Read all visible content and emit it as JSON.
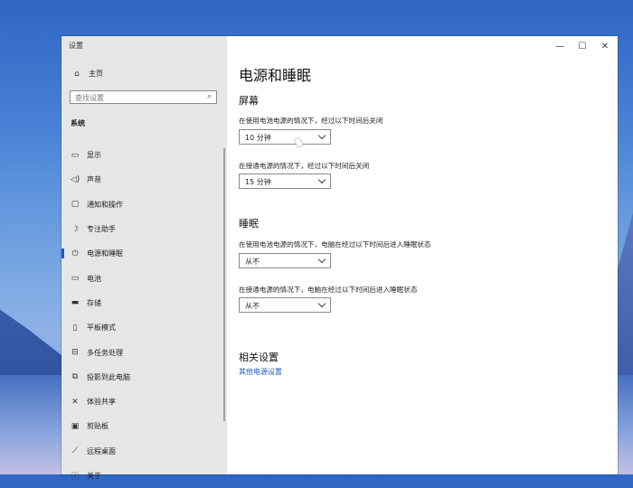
{
  "window": {
    "title": "设置",
    "controls": [
      "—",
      "☐",
      "✕"
    ]
  },
  "sidebar": {
    "home_label": "主页",
    "search_placeholder": "查找设置",
    "section": "系统",
    "items": [
      {
        "label": "显示",
        "icon": "display-icon"
      },
      {
        "label": "声音",
        "icon": "speaker-icon"
      },
      {
        "label": "通知和操作",
        "icon": "notification-icon"
      },
      {
        "label": "专注助手",
        "icon": "moon-icon"
      },
      {
        "label": "电源和睡眠",
        "icon": "power-icon",
        "active": true
      },
      {
        "label": "电池",
        "icon": "battery-icon"
      },
      {
        "label": "存储",
        "icon": "storage-icon"
      },
      {
        "label": "平板模式",
        "icon": "tablet-icon"
      },
      {
        "label": "多任务处理",
        "icon": "multitask-icon"
      },
      {
        "label": "投影到此电脑",
        "icon": "project-icon"
      },
      {
        "label": "体验共享",
        "icon": "share-icon"
      },
      {
        "label": "剪贴板",
        "icon": "clipboard-icon"
      },
      {
        "label": "远程桌面",
        "icon": "remote-desktop-icon"
      },
      {
        "label": "关于",
        "icon": "info-icon"
      }
    ]
  },
  "main": {
    "page_title": "电源和睡眠",
    "screen": {
      "heading": "屏幕",
      "battery_label": "在使用电池电源的情况下，经过以下时间后关闭",
      "battery_value": "10 分钟",
      "plugged_label": "在接通电源的情况下，经过以下时间后关闭",
      "plugged_value": "15 分钟"
    },
    "sleep": {
      "heading": "睡眠",
      "battery_label": "在使用电池电源的情况下，电脑在经过以下时间后进入睡眠状态",
      "battery_value": "从不",
      "plugged_label": "在接通电源的情况下，电脑在经过以下时间后进入睡眠状态",
      "plugged_value": "从不"
    },
    "related": {
      "heading": "相关设置",
      "link": "其他电源设置"
    }
  }
}
